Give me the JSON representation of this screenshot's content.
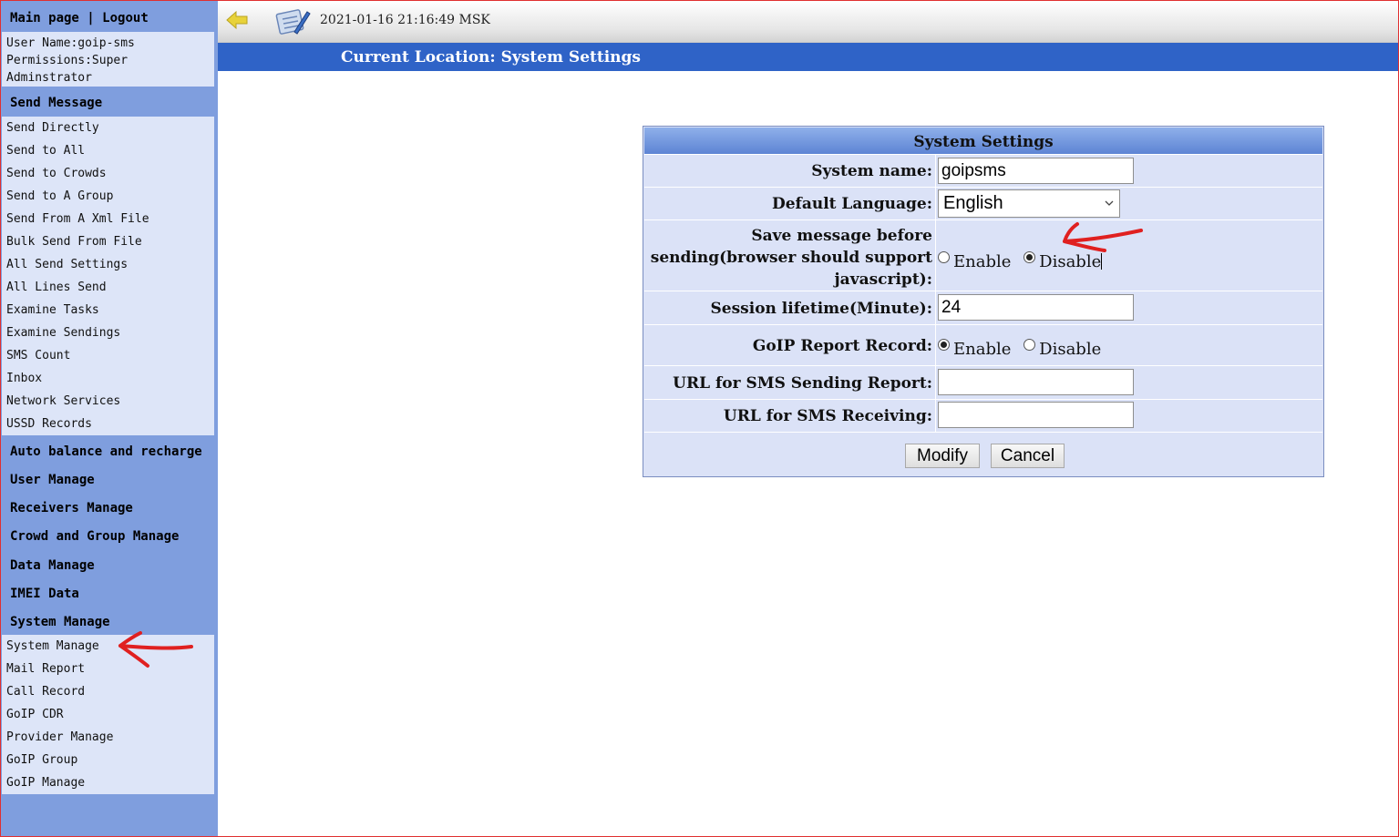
{
  "sidebar": {
    "main_page": "Main page",
    "separator": "|",
    "logout": "Logout",
    "user_name": "User Name:goip-sms",
    "permissions": "Permissions:Super Adminstrator",
    "send_message": {
      "title": "Send Message",
      "items": [
        "Send Directly",
        "Send to All",
        "Send to Crowds",
        "Send to A Group",
        "Send From A Xml File",
        "Bulk Send From File",
        "All Send Settings",
        "All Lines Send",
        "Examine Tasks",
        "Examine Sendings",
        "SMS Count",
        "Inbox",
        "Network Services",
        "USSD Records"
      ]
    },
    "headers": [
      "Auto balance and recharge",
      "User Manage",
      "Receivers Manage",
      "Crowd and Group Manage",
      "Data Manage",
      "IMEI Data",
      "System Manage"
    ],
    "system_items": [
      "System Manage",
      "Mail Report",
      "Call Record",
      "GoIP CDR",
      "Provider Manage",
      "GoIP Group",
      "GoIP Manage"
    ]
  },
  "header": {
    "datetime": "2021-01-16 21:16:49 MSK",
    "location": "Current Location: System Settings"
  },
  "form": {
    "title": "System Settings",
    "system_name_label": "System name:",
    "system_name_value": "goipsms",
    "language_label": "Default Language:",
    "language_value": "English",
    "save_msg_label_lines": [
      "Save message before",
      "sending(browser should support",
      "javascript):"
    ],
    "session_label": "Session lifetime(Minute):",
    "session_value": "24",
    "report_label": "GoIP Report Record:",
    "url_report_label": "URL for SMS Sending Report:",
    "url_report_value": "",
    "url_recv_label": "URL for SMS Receiving:",
    "url_recv_value": "",
    "enable": "Enable",
    "disable": "Disable",
    "save_msg_selected": "Disable",
    "report_selected": "Enable",
    "modify": "Modify",
    "cancel": "Cancel"
  },
  "colors": {
    "sidebar_bg": "#7f9ede",
    "submenu_bg": "#dde5f8",
    "location_bar": "#2f63c7",
    "form_bg": "#dbe2f7",
    "annotation_arrow": "#e02020"
  }
}
